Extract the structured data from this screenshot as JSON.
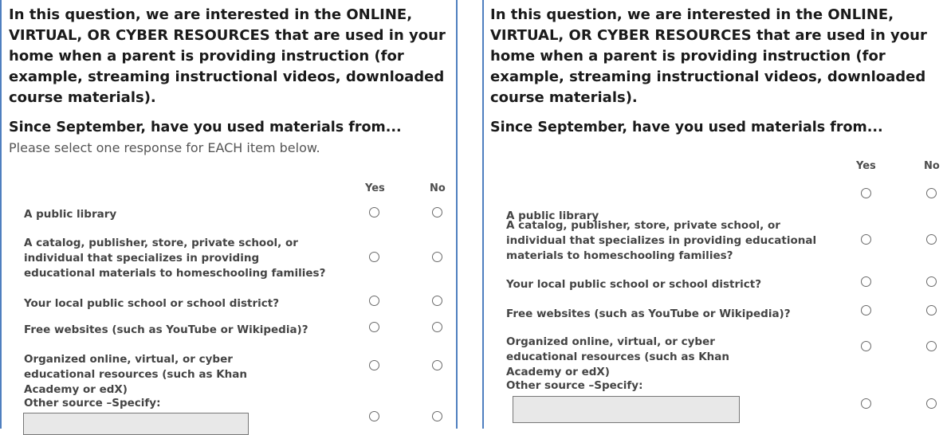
{
  "left": {
    "intro": "In this question, we are interested in the ONLINE, VIRTUAL, OR CYBER RESOURCES that are used in your home when a parent is providing instruction (for example, streaming instructional videos, downloaded course materials).",
    "subhead": "Since September, have you used materials from...",
    "instruction": "Please select one response for EACH item below.",
    "col_yes": "Yes",
    "col_no": "No",
    "items": [
      {
        "label": "A public library"
      },
      {
        "label": "A catalog, publisher, store, private school, or individual that specializes in providing educational materials to homeschooling families?"
      },
      {
        "label": "Your local public school or school district?"
      },
      {
        "label": "Free websites (such as YouTube or Wikipedia)?"
      },
      {
        "label": "Organized online, virtual, or cyber educational resources (such as Khan Academy or edX)"
      },
      {
        "label": "Other source –Specify:"
      }
    ]
  },
  "right": {
    "intro": "In this question, we are interested in the ONLINE, VIRTUAL, OR CYBER RESOURCES that are used in your home when a parent is providing instruction (for example, streaming instructional videos, downloaded course materials).",
    "subhead": "Since September, have you used materials from...",
    "col_yes": "Yes",
    "col_no": "No",
    "items": [
      {
        "label": "A public library"
      },
      {
        "label": "A catalog, publisher, store, private school, or individual that specializes in providing educational materials to homeschooling families?"
      },
      {
        "label": "Your local public school or school district?"
      },
      {
        "label": "Free websites (such as YouTube or Wikipedia)?"
      },
      {
        "label": "Organized online, virtual, or cyber educational resources (such as Khan Academy or edX)"
      },
      {
        "label": "Other source –Specify:"
      }
    ]
  }
}
